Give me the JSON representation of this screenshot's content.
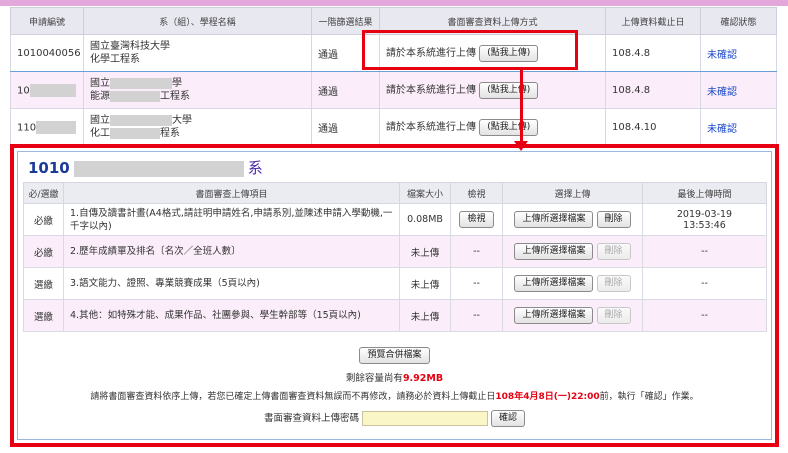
{
  "main_table": {
    "headers": [
      "申請編號",
      "系（組）、學程名稱",
      "一階篩選結果",
      "書面審查資料上傳方式",
      "上傳資料截止日",
      "確認狀態"
    ],
    "rows": [
      {
        "id": "1010040056",
        "school": "國立臺灣科技大學",
        "dept": "化學工程系",
        "result": "通過",
        "method": "請於本系統進行上傳",
        "upload_button": "(點我上傳)",
        "deadline": "108.4.8",
        "status": "未確認"
      },
      {
        "id": "10",
        "school": "國立",
        "school_tail": "學",
        "dept": "能源",
        "dept_tail": "工程系",
        "result": "通過",
        "method": "請於本系統進行上傳",
        "upload_button": "(點我上傳)",
        "deadline": "108.4.8",
        "status": "未確認"
      },
      {
        "id": "110",
        "school": "國立",
        "school_tail": "大學",
        "dept": "化工",
        "dept_tail": "程系",
        "result": "通過",
        "method": "請於本系統進行上傳",
        "upload_button": "(點我上傳)",
        "deadline": "108.4.10",
        "status": "未確認"
      }
    ]
  },
  "detail": {
    "title_prefix": "1010",
    "title_suffix": "系",
    "headers": [
      "必/選繳",
      "書面審查上傳項目",
      "檔案大小",
      "檢視",
      "選擇上傳",
      "最後上傳時間"
    ],
    "rows": [
      {
        "req": "必繳",
        "item": "1.自傳及讀書計畫(A4格式,請註明申請姓名,申請系別,並陳述申請入學動機,一千字以內)",
        "size": "0.08MB",
        "view": "檢視",
        "upload": "上傳所選擇檔案",
        "delete": "刪除",
        "time_date": "2019-03-19",
        "time_clock": "13:53:46"
      },
      {
        "req": "必繳",
        "item": "2.歷年成績單及排名〔名次／全班人數〕",
        "size": "未上傳",
        "view": "--",
        "upload": "上傳所選擇檔案",
        "delete": "刪除",
        "time_date": "--",
        "time_clock": ""
      },
      {
        "req": "選繳",
        "item": "3.語文能力、證照、專業競賽成果（5頁以內)",
        "size": "未上傳",
        "view": "--",
        "upload": "上傳所選擇檔案",
        "delete": "刪除",
        "time_date": "--",
        "time_clock": ""
      },
      {
        "req": "選繳",
        "item": "4.其他：如特殊才能、成果作品、社團參與、學生幹部等（15頁以內)",
        "size": "未上傳",
        "view": "--",
        "upload": "上傳所選擇檔案",
        "delete": "刪除",
        "time_date": "--",
        "time_clock": ""
      }
    ],
    "preview_button": "預覽合併檔案",
    "capacity_label": "剩餘容量尚有",
    "capacity_value": "9.92MB",
    "notice_pre": "請將書面審查資料依序上傳，若您已確定上傳書面審查資料無誤而不再修改，請務必於資料上傳截止日",
    "notice_deadline": "108年4月8日(一)22:00",
    "notice_post": "前，執行「確認」作業。",
    "password_label": "書面審查資料上傳密碼",
    "confirm_button": "確認"
  },
  "colors": {
    "highlight": "#e60012",
    "link": "#1a48c8",
    "title": "#1a3a9a",
    "row_alt": "#fbeefa"
  }
}
